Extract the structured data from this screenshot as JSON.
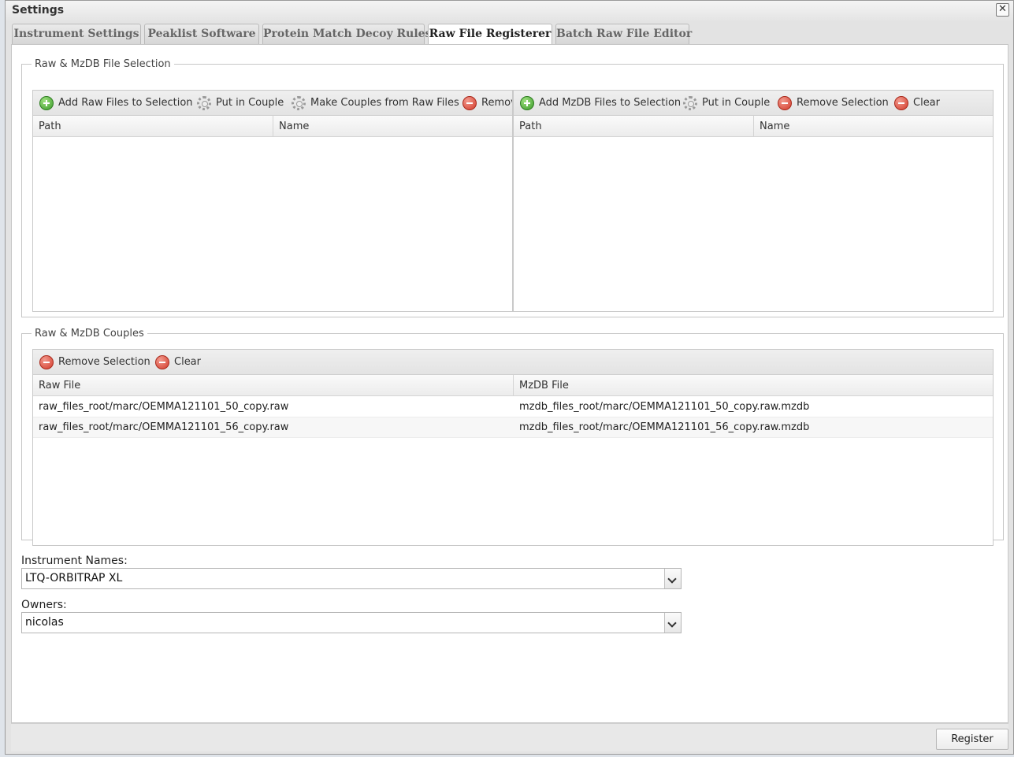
{
  "window": {
    "title": "Settings"
  },
  "tabs": [
    {
      "label": "Instrument Settings"
    },
    {
      "label": "Peaklist Software"
    },
    {
      "label": "Protein Match Decoy Rules"
    },
    {
      "label": "Raw File Registerer"
    },
    {
      "label": "Batch Raw File Editor"
    }
  ],
  "selection": {
    "legend": "Raw & MzDB File Selection",
    "raw_grid": {
      "toolbar": {
        "add": "Add Raw Files to Selection",
        "couple": "Put in Couple",
        "make_couples": "Make Couples from Raw Files",
        "remove": "Remove Selection"
      },
      "columns": [
        "Path",
        "Name"
      ]
    },
    "mzdb_grid": {
      "toolbar": {
        "add": "Add MzDB Files to Selection",
        "couple": "Put in Couple",
        "remove": "Remove Selection",
        "clear": "Clear"
      },
      "columns": [
        "Path",
        "Name"
      ]
    }
  },
  "couples": {
    "legend": "Raw & MzDB Couples",
    "toolbar": {
      "remove": "Remove Selection",
      "clear": "Clear"
    },
    "columns": [
      "Raw File",
      "MzDB File"
    ],
    "rows": [
      {
        "raw": "raw_files_root/marc/OEMMA121101_50_copy.raw",
        "mzdb": "mzdb_files_root/marc/OEMMA121101_50_copy.raw.mzdb"
      },
      {
        "raw": "raw_files_root/marc/OEMMA121101_56_copy.raw",
        "mzdb": "mzdb_files_root/marc/OEMMA121101_56_copy.raw.mzdb"
      }
    ]
  },
  "form": {
    "instrument_label": "Instrument Names:",
    "instrument_value": "LTQ-ORBITRAP XL",
    "owners_label": "Owners:",
    "owners_value": "nicolas"
  },
  "footer": {
    "register_label": "Register"
  },
  "icons": {
    "add": "add-circle-icon",
    "remove": "remove-circle-icon",
    "gear": "gear-icon",
    "close": "close-icon",
    "dropdown": "chevron-down-icon"
  }
}
